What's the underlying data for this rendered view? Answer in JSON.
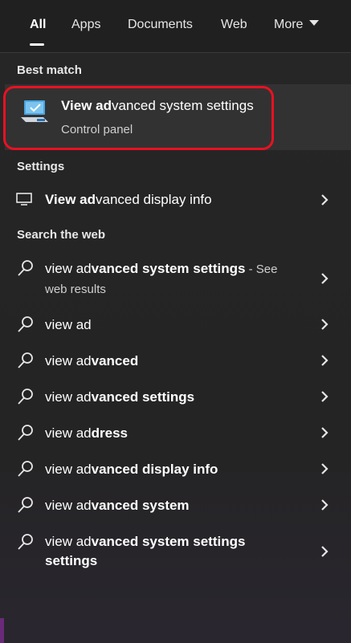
{
  "tabs": {
    "all": "All",
    "apps": "Apps",
    "documents": "Documents",
    "web": "Web",
    "more": "More"
  },
  "sections": {
    "best_match": "Best match",
    "settings": "Settings",
    "search_the_web": "Search the web"
  },
  "best_match": {
    "title_bold": "View ad",
    "title_rest": "vanced system settings",
    "subtitle": "Control panel",
    "icon": "system-settings-monitor-icon"
  },
  "settings_item": {
    "bold": "View ad",
    "rest": "vanced display info",
    "icon": "monitor-icon"
  },
  "web_results": [
    {
      "line1_plain": "view ad",
      "line1_bold": "vanced system settings",
      "see": " - See",
      "line2": "web results"
    },
    {
      "plain": "view ad",
      "bold": ""
    },
    {
      "plain": "view ad",
      "bold": "vanced"
    },
    {
      "plain": "view ad",
      "bold": "vanced settings"
    },
    {
      "plain": "view ad",
      "bold": "dress"
    },
    {
      "plain": "view ad",
      "bold": "vanced display info"
    },
    {
      "plain": "view ad",
      "bold": "vanced system"
    },
    {
      "line1_plain": "view ad",
      "line1_bold": "vanced system settings",
      "line2_bold": "settings"
    }
  ],
  "colors": {
    "highlight_ring": "#e81123",
    "accent_monitor": "#4aa3df"
  }
}
